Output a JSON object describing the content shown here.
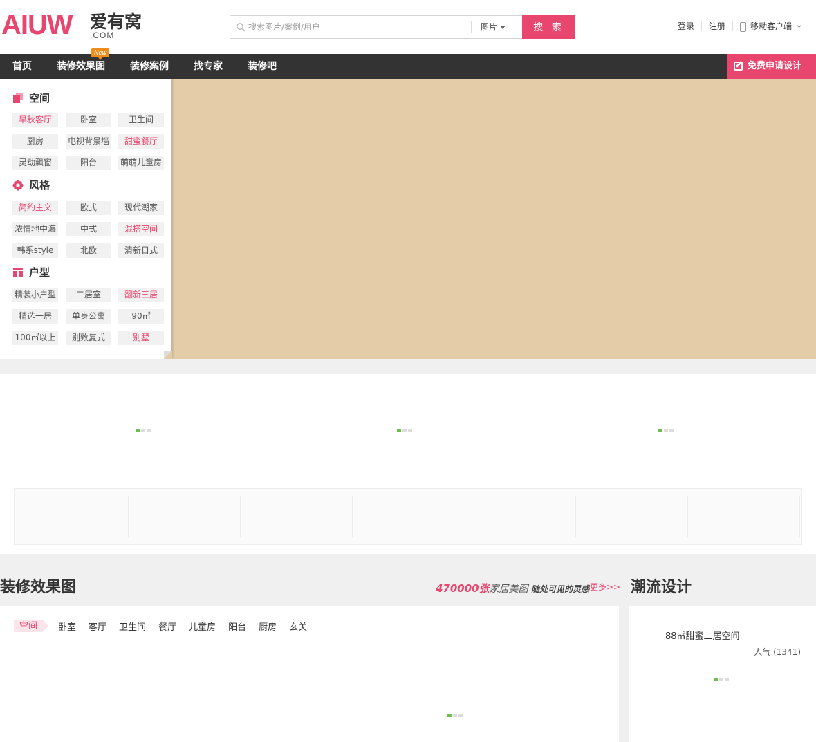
{
  "header": {
    "logo_text": "AIUW",
    "logo_cn": "爱有窝",
    "logo_domain": ".COM",
    "search_placeholder": "搜索图片/案例/用户",
    "search_type": "图片",
    "search_button": "搜 索",
    "login": "登录",
    "register": "注册",
    "mobile": "移动客户端"
  },
  "nav": {
    "items": [
      "首页",
      "装修效果图",
      "装修案例",
      "找专家",
      "装修吧"
    ],
    "badge": "New",
    "apply": "免费申请设计"
  },
  "categories": [
    {
      "title": "空间",
      "icon": "space-icon",
      "tags": [
        {
          "label": "早秋客厅",
          "hl": true
        },
        {
          "label": "卧室"
        },
        {
          "label": "卫生间"
        },
        {
          "label": "厨房"
        },
        {
          "label": "电视背景墙"
        },
        {
          "label": "甜蜜餐厅",
          "hl": true
        },
        {
          "label": "灵动飘窗"
        },
        {
          "label": "阳台"
        },
        {
          "label": "萌萌儿童房"
        }
      ]
    },
    {
      "title": "风格",
      "icon": "flower-icon",
      "tags": [
        {
          "label": "简约主义",
          "hl": true
        },
        {
          "label": "欧式"
        },
        {
          "label": "现代潮家"
        },
        {
          "label": "浓情地中海"
        },
        {
          "label": "中式"
        },
        {
          "label": "混搭空间",
          "hl": true
        },
        {
          "label": "韩系style"
        },
        {
          "label": "北欧"
        },
        {
          "label": "清新日式"
        }
      ]
    },
    {
      "title": "户型",
      "icon": "floorplan-icon",
      "tags": [
        {
          "label": "精装小户型"
        },
        {
          "label": "二居室"
        },
        {
          "label": "翻新三居",
          "hl": true
        },
        {
          "label": "精选一居"
        },
        {
          "label": "单身公寓"
        },
        {
          "label": "90㎡"
        },
        {
          "label": "100㎡以上"
        },
        {
          "label": "别致复式"
        },
        {
          "label": "别墅",
          "hl": true
        }
      ]
    }
  ],
  "section": {
    "title": "装修效果图",
    "slogan_num": "470000张",
    "slogan_text": "家居美图",
    "slogan_small": "随处可见的灵感",
    "more": "更多>>",
    "room_tabs": [
      "空间",
      "卧室",
      "客厅",
      "卫生间",
      "餐厅",
      "儿童房",
      "阳台",
      "厨房",
      "玄关"
    ]
  },
  "trend": {
    "title": "潮流设计",
    "item_title": "88㎡甜蜜二居空间",
    "popularity": "人气 (1341)"
  },
  "colors": {
    "brand": "#e8466e",
    "nav_bg": "#333333",
    "hero_bg": "#e4cca8"
  }
}
